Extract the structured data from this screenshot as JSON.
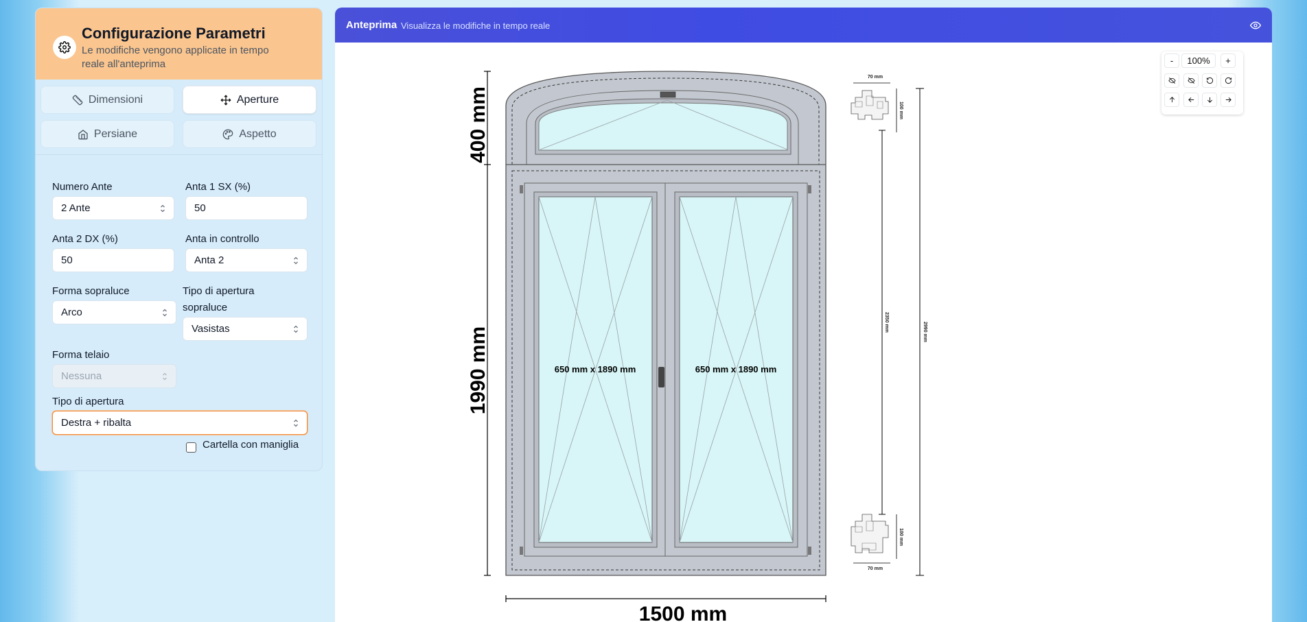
{
  "sidebar": {
    "title": "Configurazione Parametri",
    "subtitle": "Le modifiche vengono applicate in tempo reale all'anteprima",
    "tabs": [
      {
        "label": "Dimensioni",
        "icon": "ruler-icon",
        "active": false
      },
      {
        "label": "Aperture",
        "icon": "move-icon",
        "active": true
      },
      {
        "label": "Persiane",
        "icon": "home-icon",
        "active": false
      },
      {
        "label": "Aspetto",
        "icon": "palette-icon",
        "active": false
      }
    ],
    "fields": {
      "numero_ante": {
        "label": "Numero Ante",
        "value": "2 Ante"
      },
      "anta1": {
        "label": "Anta 1 SX (%)",
        "value": "50"
      },
      "anta2": {
        "label": "Anta 2 DX (%)",
        "value": "50"
      },
      "anta_controllo": {
        "label": "Anta in controllo",
        "value": "Anta 2"
      },
      "forma_sopraluce": {
        "label": "Forma sopraluce",
        "value": "Arco"
      },
      "tipo_apertura_sopraluce": {
        "label_line1": "Tipo di apertura",
        "label_line2": "sopraluce",
        "value": "Vasistas"
      },
      "forma_telaio": {
        "label": "Forma telaio",
        "value": "Nessuna"
      },
      "tipo_apertura": {
        "label": "Tipo di apertura",
        "value": "Destra + ribalta"
      }
    },
    "checkbox": {
      "label": "Cartella con maniglia",
      "checked": false
    }
  },
  "preview": {
    "title": "Anteprima",
    "subtitle": "Visualizza le modifiche in tempo reale",
    "zoom": {
      "value": "100%",
      "minus": "-",
      "plus": "+"
    },
    "dimensions": {
      "top_height": "400 mm",
      "main_height": "1990 mm",
      "width": "1500 mm",
      "sash_left": "650 mm x 1890 mm",
      "sash_right": "650 mm x 1890 mm",
      "section_height": "2350 mm",
      "total_height": "2990 mm",
      "profile_top_width": "70 mm",
      "profile_bottom_width": "70 mm",
      "profile_top_side": "100 mm",
      "profile_bottom_side": "100 mm"
    }
  },
  "colors": {
    "accent_orange": "#fac58e",
    "preview_bar": "#4050e0",
    "glass": "#d8f6f7",
    "frame": "#c3c8d0"
  }
}
